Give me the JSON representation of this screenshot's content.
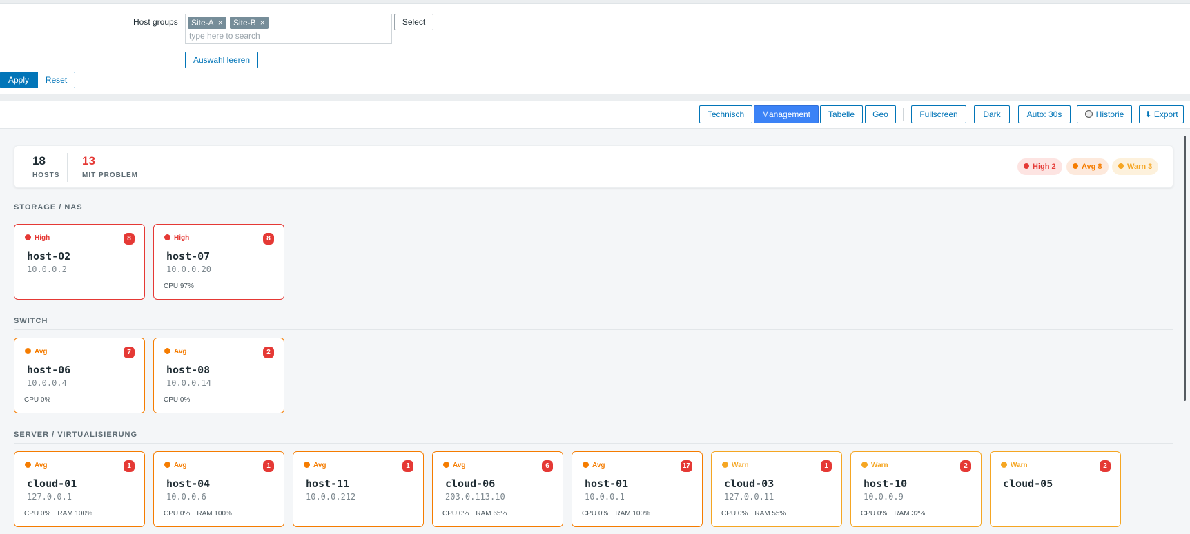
{
  "filter": {
    "host_groups_label": "Host groups",
    "chips": [
      {
        "label": "Site-A"
      },
      {
        "label": "Site-B"
      }
    ],
    "chip_remove": "×",
    "search_placeholder": "type here to search",
    "select_label": "Select",
    "clear_label": "Auswahl leeren",
    "apply_label": "Apply",
    "reset_label": "Reset"
  },
  "toolbar": {
    "views": [
      "Technisch",
      "Management",
      "Tabelle",
      "Geo"
    ],
    "active_view": "Management",
    "actions": [
      "Fullscreen",
      "Dark",
      "Auto: 30s",
      "Historie",
      "⬇ Export"
    ]
  },
  "summary": {
    "hosts_count": "18",
    "hosts_label": "HOSTS",
    "problem_count": "13",
    "problem_label": "MIT PROBLEM",
    "pills": [
      {
        "label": "High 2",
        "severity": "high"
      },
      {
        "label": "Avg 8",
        "severity": "avg"
      },
      {
        "label": "Warn 3",
        "severity": "warn"
      }
    ]
  },
  "colors": {
    "high": "#e53935",
    "avg": "#f57c00",
    "warn": "#f5a623",
    "accent": "#0275b8",
    "active_tab": "#3b82f6"
  },
  "sections": [
    {
      "title": "STORAGE / NAS",
      "hosts": [
        {
          "severity": "high",
          "severity_label": "High",
          "count": "8",
          "name": "host-02",
          "ip": "10.0.0.2",
          "metrics": []
        },
        {
          "severity": "high",
          "severity_label": "High",
          "count": "8",
          "name": "host-07",
          "ip": "10.0.0.20",
          "metrics": [
            "CPU 97%"
          ]
        }
      ]
    },
    {
      "title": "SWITCH",
      "hosts": [
        {
          "severity": "avg",
          "severity_label": "Avg",
          "count": "7",
          "name": "host-06",
          "ip": "10.0.0.4",
          "metrics": [
            "CPU 0%"
          ]
        },
        {
          "severity": "avg",
          "severity_label": "Avg",
          "count": "2",
          "name": "host-08",
          "ip": "10.0.0.14",
          "metrics": [
            "CPU 0%"
          ]
        }
      ]
    },
    {
      "title": "SERVER / VIRTUALISIERUNG",
      "hosts": [
        {
          "severity": "avg",
          "severity_label": "Avg",
          "count": "1",
          "name": "cloud-01",
          "ip": "127.0.0.1",
          "metrics": [
            "CPU 0%",
            "RAM 100%"
          ]
        },
        {
          "severity": "avg",
          "severity_label": "Avg",
          "count": "1",
          "name": "host-04",
          "ip": "10.0.0.6",
          "metrics": [
            "CPU 0%",
            "RAM 100%"
          ]
        },
        {
          "severity": "avg",
          "severity_label": "Avg",
          "count": "1",
          "name": "host-11",
          "ip": "10.0.0.212",
          "metrics": []
        },
        {
          "severity": "avg",
          "severity_label": "Avg",
          "count": "6",
          "name": "cloud-06",
          "ip": "203.0.113.10",
          "metrics": [
            "CPU 0%",
            "RAM 65%"
          ]
        },
        {
          "severity": "avg",
          "severity_label": "Avg",
          "count": "17",
          "name": "host-01",
          "ip": "10.0.0.1",
          "metrics": [
            "CPU 0%",
            "RAM 100%"
          ]
        },
        {
          "severity": "warn",
          "severity_label": "Warn",
          "count": "1",
          "name": "cloud-03",
          "ip": "127.0.0.11",
          "metrics": [
            "CPU 0%",
            "RAM 55%"
          ]
        },
        {
          "severity": "warn",
          "severity_label": "Warn",
          "count": "2",
          "name": "host-10",
          "ip": "10.0.0.9",
          "metrics": [
            "CPU 0%",
            "RAM 32%"
          ]
        },
        {
          "severity": "warn",
          "severity_label": "Warn",
          "count": "2",
          "name": "cloud-05",
          "ip": "—",
          "metrics": []
        }
      ]
    }
  ]
}
